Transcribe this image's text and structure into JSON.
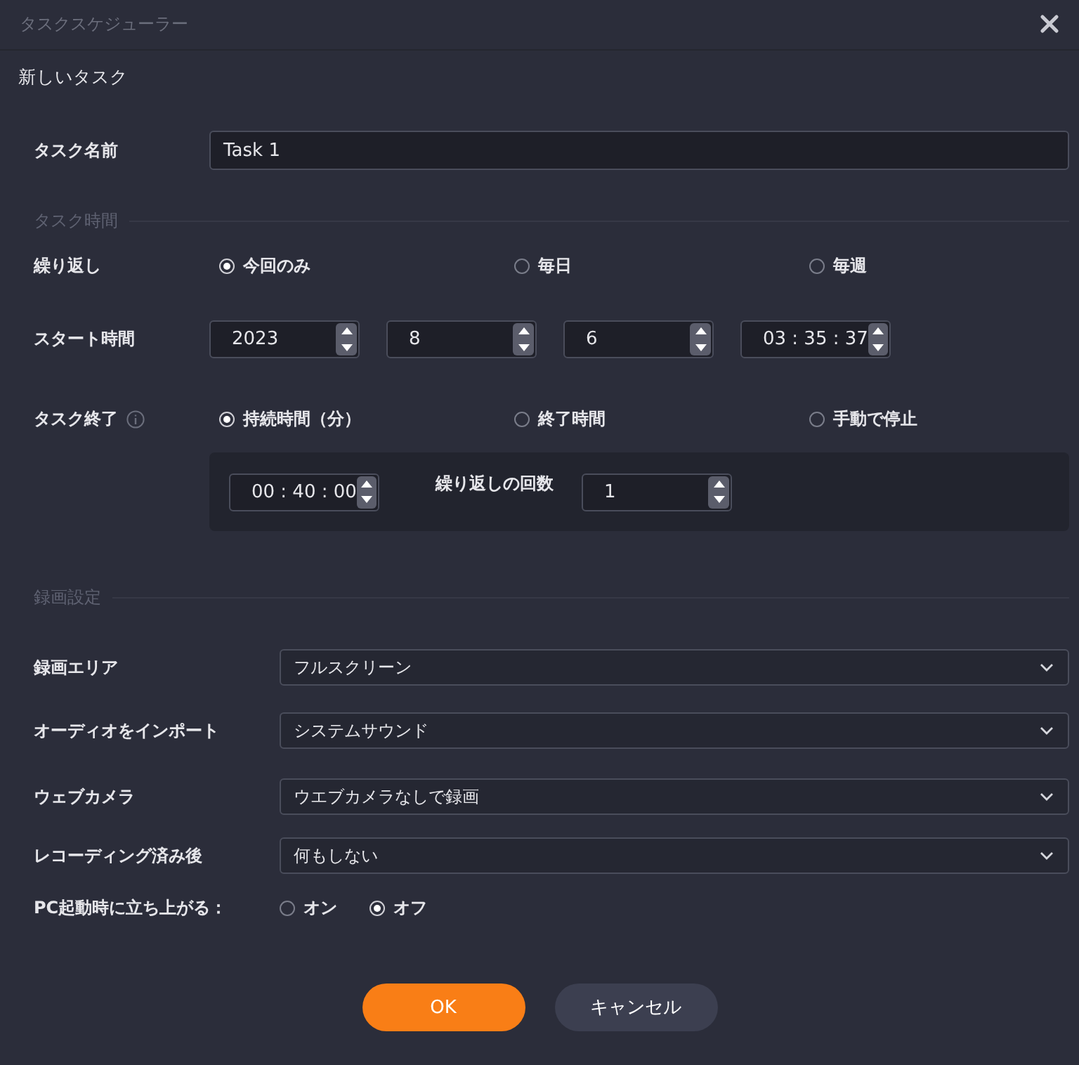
{
  "window": {
    "title": "タスクスケジューラー"
  },
  "heading": "新しいタスク",
  "task_name": {
    "label": "タスク名前",
    "value": "Task 1"
  },
  "task_time": {
    "title": "タスク時間",
    "repeat": {
      "label": "繰り返し",
      "options": [
        {
          "label": "今回のみ",
          "selected": true
        },
        {
          "label": "毎日",
          "selected": false
        },
        {
          "label": "毎週",
          "selected": false
        }
      ]
    },
    "start_time": {
      "label": "スタート時間",
      "fields": [
        {
          "value": "2023"
        },
        {
          "value": "8"
        },
        {
          "value": "6"
        },
        {
          "value": "03 : 35 : 37"
        }
      ]
    },
    "task_end": {
      "label": "タスク終了",
      "options": [
        {
          "label": "持続時間（分）",
          "selected": true
        },
        {
          "label": "終了時間",
          "selected": false
        },
        {
          "label": "手動で停止",
          "selected": false
        }
      ],
      "duration": {
        "value": "00 : 40 : 00"
      },
      "repeat_count": {
        "label": "繰り返しの回数",
        "value": "1"
      }
    }
  },
  "recording": {
    "title": "録画設定",
    "settings": [
      {
        "label": "録画エリア",
        "value": "フルスクリーン"
      },
      {
        "label": "オーディオをインポート",
        "value": "システムサウンド"
      },
      {
        "label": "ウェブカメラ",
        "value": "ウエブカメラなしで録画"
      },
      {
        "label": "レコーディング済み後",
        "value": "何もしない"
      }
    ],
    "startup": {
      "label": "PC起動時に立ち上がる：",
      "options": [
        {
          "label": "オン",
          "selected": false
        },
        {
          "label": "オフ",
          "selected": true
        }
      ]
    }
  },
  "buttons": [
    {
      "label": "OK",
      "kind": "primary"
    },
    {
      "label": "キャンセル",
      "kind": "secondary"
    }
  ]
}
